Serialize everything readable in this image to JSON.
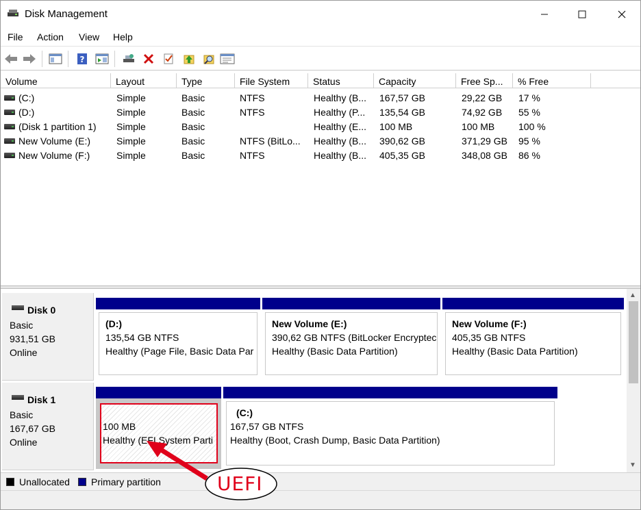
{
  "window": {
    "title": "Disk Management",
    "minimize": "—",
    "maximize": "☐",
    "close": "✕"
  },
  "menu": [
    "File",
    "Action",
    "View",
    "Help"
  ],
  "toolbar": {
    "icons": [
      "back-arrow-icon",
      "forward-arrow-icon",
      "console-tree-icon",
      "help-icon",
      "action-pane-icon",
      "connect-disk-icon",
      "delete-icon",
      "check-icon",
      "up-arrow-folder-icon",
      "search-folder-icon",
      "properties-icon"
    ]
  },
  "volume_list": {
    "columns": [
      "Volume",
      "Layout",
      "Type",
      "File System",
      "Status",
      "Capacity",
      "Free Sp...",
      "% Free"
    ],
    "rows": [
      {
        "volume": "(C:)",
        "layout": "Simple",
        "type": "Basic",
        "fs": "NTFS",
        "status": "Healthy (B...",
        "capacity": "167,57 GB",
        "free": "29,22 GB",
        "pct": "17 %"
      },
      {
        "volume": "(D:)",
        "layout": "Simple",
        "type": "Basic",
        "fs": "NTFS",
        "status": "Healthy (P...",
        "capacity": "135,54 GB",
        "free": "74,92 GB",
        "pct": "55 %"
      },
      {
        "volume": "(Disk 1 partition 1)",
        "layout": "Simple",
        "type": "Basic",
        "fs": "",
        "status": "Healthy (E...",
        "capacity": "100 MB",
        "free": "100 MB",
        "pct": "100 %"
      },
      {
        "volume": "New Volume (E:)",
        "layout": "Simple",
        "type": "Basic",
        "fs": "NTFS (BitLo...",
        "status": "Healthy (B...",
        "capacity": "390,62 GB",
        "free": "371,29 GB",
        "pct": "95 %"
      },
      {
        "volume": "New Volume (F:)",
        "layout": "Simple",
        "type": "Basic",
        "fs": "NTFS",
        "status": "Healthy (B...",
        "capacity": "405,35 GB",
        "free": "348,08 GB",
        "pct": "86 %"
      }
    ]
  },
  "disks": [
    {
      "name": "Disk 0",
      "type": "Basic",
      "size": "931,51 GB",
      "state": "Online",
      "partitions": [
        {
          "name": "(D:)",
          "size": "135,54 GB NTFS",
          "status": "Healthy (Page File, Basic Data Par"
        },
        {
          "name": "New Volume  (E:)",
          "size": "390,62 GB NTFS (BitLocker Encryptec",
          "status": "Healthy (Basic Data Partition)"
        },
        {
          "name": "New Volume  (F:)",
          "size": "405,35 GB NTFS",
          "status": "Healthy (Basic Data Partition)"
        }
      ]
    },
    {
      "name": "Disk 1",
      "type": "Basic",
      "size": "167,67 GB",
      "state": "Online",
      "partitions": [
        {
          "name": "",
          "size": "100 MB",
          "status": "Healthy (EFI System Parti"
        },
        {
          "name": "(C:)",
          "size": "167,57 GB NTFS",
          "status": "Healthy (Boot, Crash Dump, Basic Data Partition)"
        }
      ]
    }
  ],
  "legend": {
    "unallocated": "Unallocated",
    "primary": "Primary partition",
    "unallocated_color": "#000000",
    "primary_color": "#00008b"
  },
  "annotation": {
    "label": "UEFI",
    "color": "#e0001a"
  }
}
